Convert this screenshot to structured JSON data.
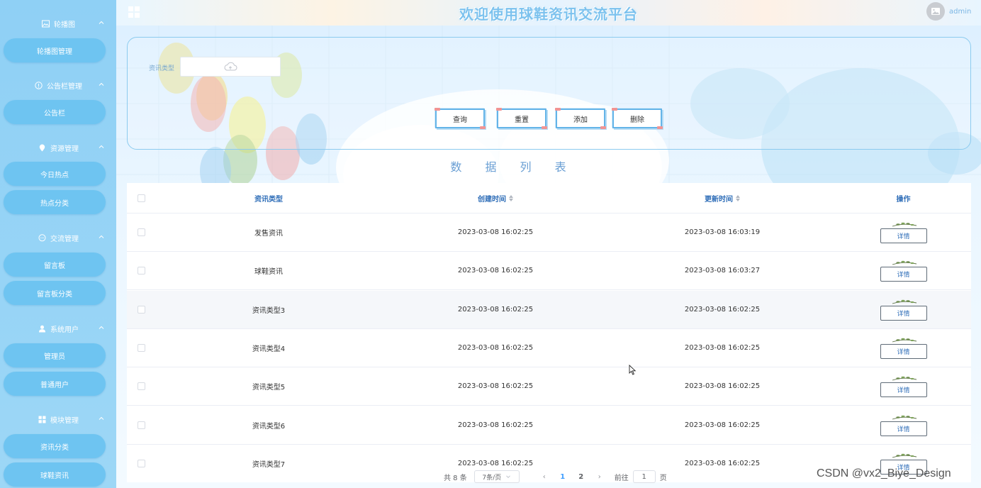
{
  "sidebar": {
    "groups": [
      {
        "label": "轮播图",
        "icon": "image-icon",
        "items": [
          "轮播图管理"
        ]
      },
      {
        "label": "公告栏管理",
        "icon": "info-circle-icon",
        "items": [
          "公告栏"
        ]
      },
      {
        "label": "资源管理",
        "icon": "location-pin-icon",
        "items": [
          "今日热点",
          "热点分类"
        ]
      },
      {
        "label": "交流管理",
        "icon": "chat-bubble-icon",
        "items": [
          "留言板",
          "留言板分类"
        ]
      },
      {
        "label": "系统用户",
        "icon": "user-icon",
        "items": [
          "管理员",
          "普通用户"
        ]
      },
      {
        "label": "模块管理",
        "icon": "grid-icon",
        "items": [
          "资讯分类",
          "球鞋资讯"
        ]
      }
    ]
  },
  "header": {
    "title": "欢迎使用球鞋资讯交流平台",
    "username": "admin"
  },
  "search": {
    "filter_label": "资讯类型",
    "buttons": {
      "query": "查询",
      "reset": "重置",
      "add": "添加",
      "delete": "删除"
    }
  },
  "list_title": "数 据 列 表",
  "table": {
    "columns": {
      "type": "资讯类型",
      "created": "创建时间",
      "updated": "更新时间",
      "ops": "操作"
    },
    "detail_label": "详情",
    "rows": [
      {
        "type": "发售资讯",
        "created": "2023-03-08 16:02:25",
        "updated": "2023-03-08 16:03:19"
      },
      {
        "type": "球鞋资讯",
        "created": "2023-03-08 16:02:25",
        "updated": "2023-03-08 16:03:27"
      },
      {
        "type": "资讯类型3",
        "created": "2023-03-08 16:02:25",
        "updated": "2023-03-08 16:02:25"
      },
      {
        "type": "资讯类型4",
        "created": "2023-03-08 16:02:25",
        "updated": "2023-03-08 16:02:25"
      },
      {
        "type": "资讯类型5",
        "created": "2023-03-08 16:02:25",
        "updated": "2023-03-08 16:02:25"
      },
      {
        "type": "资讯类型6",
        "created": "2023-03-08 16:02:25",
        "updated": "2023-03-08 16:02:25"
      },
      {
        "type": "资讯类型7",
        "created": "2023-03-08 16:02:25",
        "updated": "2023-03-08 16:02:25"
      }
    ]
  },
  "pagination": {
    "total": "共 8 条",
    "page_size": "7条/页",
    "pages": [
      "1",
      "2"
    ],
    "current_page": "1",
    "jump_prefix": "前往",
    "jump_value": "1",
    "jump_suffix": "页"
  },
  "watermark": "CSDN @vx2_Biye_Design",
  "colors": {
    "sidebar": "#8fd0f5",
    "menu_item": "#6ec4f1",
    "accent": "#409eff",
    "title": "#7cc2ee"
  }
}
